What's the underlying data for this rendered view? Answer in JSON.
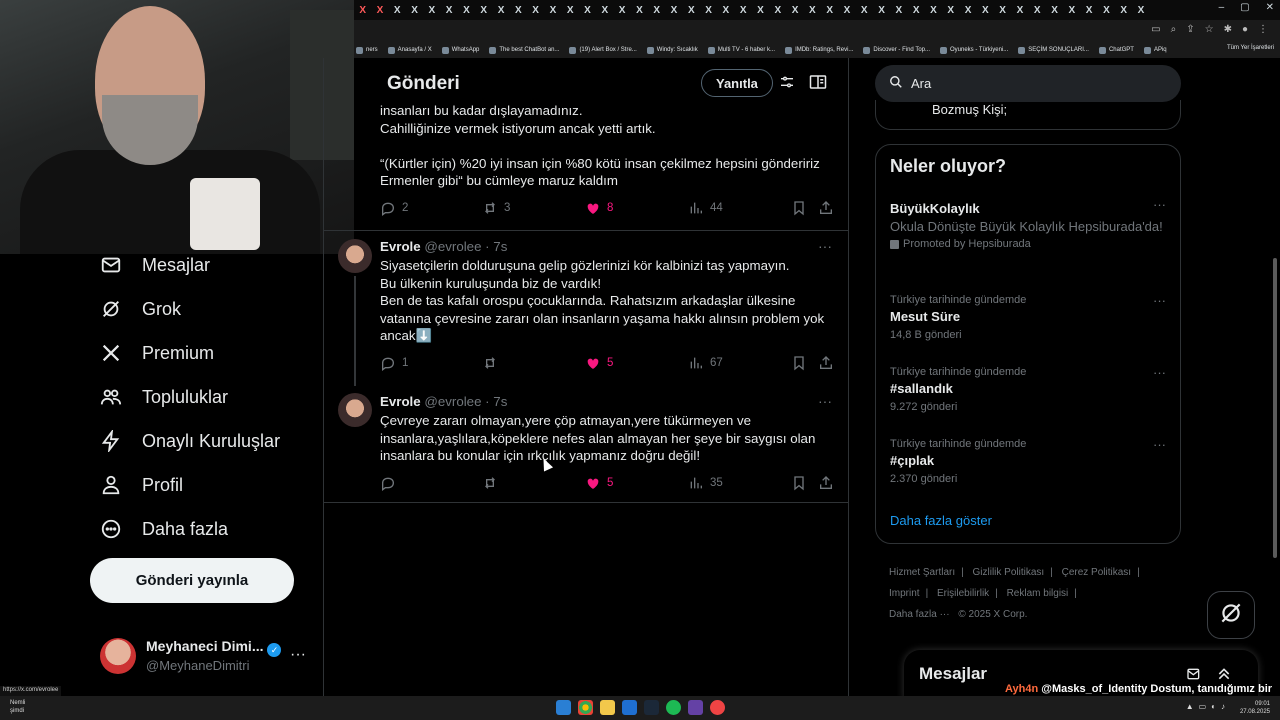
{
  "browser": {
    "tab_glyph": "X",
    "bookmarks": [
      {
        "label": "ners",
        "icon": "bookmark-icon"
      },
      {
        "label": "Anasayfa / X",
        "icon": "x-logo-icon"
      },
      {
        "label": "WhatsApp",
        "icon": "whatsapp-icon"
      },
      {
        "label": "The best ChatBot an...",
        "icon": "bookmark-icon"
      },
      {
        "label": "(19) Alert Box / Stre...",
        "icon": "bookmark-icon"
      },
      {
        "label": "Windy: Sıcaklık",
        "icon": "bookmark-icon"
      },
      {
        "label": "Multi TV - 6 haber k...",
        "icon": "bookmark-icon"
      },
      {
        "label": "IMDb: Ratings, Revi...",
        "icon": "bookmark-icon"
      },
      {
        "label": "Discover - Find Top...",
        "icon": "bookmark-icon"
      },
      {
        "label": "Oyuneks - Türkiyeni...",
        "icon": "bookmark-icon"
      },
      {
        "label": "SEÇİM SONUÇLARI...",
        "icon": "bookmark-icon"
      },
      {
        "label": "ChatGPT",
        "icon": "bookmark-icon"
      },
      {
        "label": "APiq",
        "icon": "bookmark-icon"
      }
    ],
    "all_bookmarks": "Tüm Yer İşaretleri",
    "status_url": "https://x.com/evrolee"
  },
  "nav": {
    "items": [
      {
        "label": "Mesajlar",
        "icon": "envelope-icon"
      },
      {
        "label": "Grok",
        "icon": "grok-icon"
      },
      {
        "label": "Premium",
        "icon": "x-logo-icon"
      },
      {
        "label": "Topluluklar",
        "icon": "people-icon"
      },
      {
        "label": "Onaylı Kuruluşlar",
        "icon": "lightning-icon"
      },
      {
        "label": "Profil",
        "icon": "person-icon"
      },
      {
        "label": "Daha fazla",
        "icon": "more-circle-icon"
      }
    ],
    "post_button": "Gönderi yayınla",
    "account": {
      "name": "Meyhaneci Dimi...",
      "handle": "@MeyhaneDimitri"
    }
  },
  "main": {
    "title": "Gönderi",
    "reply_button": "Yanıtla",
    "tweets": [
      {
        "lines": [
          "insanları bu kadar dışlayamadınız.",
          "Cahilliğinize vermek istiyorum ancak yetti artık.",
          "",
          "“(Kürtler için) %20 iyi insan için %80 kötü insan çekilmez hepsini göndeririz Ermenler gibi“ bu cümleye maruz kaldım"
        ],
        "replies": "2",
        "reposts": "3",
        "likes": "8",
        "views": "44"
      },
      {
        "name": "Evrole",
        "handle": "@evrolee",
        "time": "7s",
        "text": "Siyasetçilerin dolduruşuna gelip gözlerinizi kör kalbinizi taş yapmayın.\nBu ülkenin kuruluşunda biz de vardık!\nBen de tas kafalı orospu çocuklarında. Rahatsızım arkadaşlar ülkesine vatanına çevresine zararı olan insanların yaşama hakkı alınsın problem yok ancak⬇️",
        "replies": "1",
        "reposts": "",
        "likes": "5",
        "views": "67"
      },
      {
        "name": "Evrole",
        "handle": "@evrolee",
        "time": "7s",
        "text": "Çevreye zararı olmayan,yere çöp atmayan,yere tükürmeyen ve insanlara,yaşlılara,köpeklere nefes alan almayan her şeye bir saygısı olan insanlara bu konular için ırkçılık yapmanız doğru değil!",
        "replies": "",
        "reposts": "",
        "likes": "5",
        "views": "35"
      }
    ]
  },
  "right": {
    "search_placeholder": "Ara",
    "prev_card_text": "Bozmuş Kişi;",
    "trends_title": "Neler oluyor?",
    "promoted": {
      "name": "BüyükKolaylık",
      "desc": "Okula Dönüşte Büyük Kolaylık Hepsiburada'da!",
      "promo": "Promoted by Hepsiburada"
    },
    "trends": [
      {
        "context": "Türkiye tarihinde gündemde",
        "name": "Mesut Süre",
        "count": "14,8 B gönderi"
      },
      {
        "context": "Türkiye tarihinde gündemde",
        "name": "#sallandık",
        "count": "9.272 gönderi"
      },
      {
        "context": "Türkiye tarihinde gündemde",
        "name": "#çıplak",
        "count": "2.370 gönderi"
      }
    ],
    "show_more": "Daha fazla göster",
    "footer": {
      "row1": [
        "Hizmet Şartları",
        "|",
        "Gizlilik Politikası",
        "|",
        "Çerez Politikası",
        "|"
      ],
      "row2": [
        "Imprint",
        "|",
        "Erişilebilirlik",
        "|",
        "Reklam bilgisi",
        "|"
      ],
      "row3": [
        "Daha fazla ···",
        "© 2025 X Corp."
      ]
    },
    "messages_drawer": "Mesajlar"
  },
  "chat": {
    "user": "Ayh4n",
    "message": "@Masks_of_Identity Dostum, tanıdığımız bir insan kendisi. Öyle dertleri yok."
  },
  "taskbar": {
    "weather_line1": "Nemli",
    "weather_line2": "şimdi",
    "time": "09:01",
    "date": "27.08.2025"
  },
  "colors": {
    "like": "#f91880",
    "link": "#1d9bf0",
    "muted": "#71767b",
    "border": "#2f3336"
  }
}
